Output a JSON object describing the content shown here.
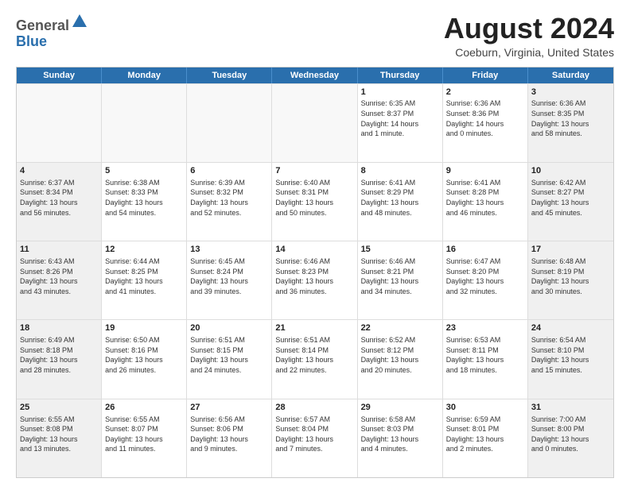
{
  "logo": {
    "general": "General",
    "blue": "Blue"
  },
  "header": {
    "month": "August 2024",
    "location": "Coeburn, Virginia, United States"
  },
  "days": [
    "Sunday",
    "Monday",
    "Tuesday",
    "Wednesday",
    "Thursday",
    "Friday",
    "Saturday"
  ],
  "rows": [
    [
      {
        "day": "",
        "empty": true
      },
      {
        "day": "",
        "empty": true
      },
      {
        "day": "",
        "empty": true
      },
      {
        "day": "",
        "empty": true
      },
      {
        "day": "1",
        "lines": [
          "Sunrise: 6:35 AM",
          "Sunset: 8:37 PM",
          "Daylight: 14 hours",
          "and 1 minute."
        ]
      },
      {
        "day": "2",
        "lines": [
          "Sunrise: 6:36 AM",
          "Sunset: 8:36 PM",
          "Daylight: 14 hours",
          "and 0 minutes."
        ]
      },
      {
        "day": "3",
        "shaded": true,
        "lines": [
          "Sunrise: 6:36 AM",
          "Sunset: 8:35 PM",
          "Daylight: 13 hours",
          "and 58 minutes."
        ]
      }
    ],
    [
      {
        "day": "4",
        "shaded": true,
        "lines": [
          "Sunrise: 6:37 AM",
          "Sunset: 8:34 PM",
          "Daylight: 13 hours",
          "and 56 minutes."
        ]
      },
      {
        "day": "5",
        "lines": [
          "Sunrise: 6:38 AM",
          "Sunset: 8:33 PM",
          "Daylight: 13 hours",
          "and 54 minutes."
        ]
      },
      {
        "day": "6",
        "lines": [
          "Sunrise: 6:39 AM",
          "Sunset: 8:32 PM",
          "Daylight: 13 hours",
          "and 52 minutes."
        ]
      },
      {
        "day": "7",
        "lines": [
          "Sunrise: 6:40 AM",
          "Sunset: 8:31 PM",
          "Daylight: 13 hours",
          "and 50 minutes."
        ]
      },
      {
        "day": "8",
        "lines": [
          "Sunrise: 6:41 AM",
          "Sunset: 8:29 PM",
          "Daylight: 13 hours",
          "and 48 minutes."
        ]
      },
      {
        "day": "9",
        "lines": [
          "Sunrise: 6:41 AM",
          "Sunset: 8:28 PM",
          "Daylight: 13 hours",
          "and 46 minutes."
        ]
      },
      {
        "day": "10",
        "shaded": true,
        "lines": [
          "Sunrise: 6:42 AM",
          "Sunset: 8:27 PM",
          "Daylight: 13 hours",
          "and 45 minutes."
        ]
      }
    ],
    [
      {
        "day": "11",
        "shaded": true,
        "lines": [
          "Sunrise: 6:43 AM",
          "Sunset: 8:26 PM",
          "Daylight: 13 hours",
          "and 43 minutes."
        ]
      },
      {
        "day": "12",
        "lines": [
          "Sunrise: 6:44 AM",
          "Sunset: 8:25 PM",
          "Daylight: 13 hours",
          "and 41 minutes."
        ]
      },
      {
        "day": "13",
        "lines": [
          "Sunrise: 6:45 AM",
          "Sunset: 8:24 PM",
          "Daylight: 13 hours",
          "and 39 minutes."
        ]
      },
      {
        "day": "14",
        "lines": [
          "Sunrise: 6:46 AM",
          "Sunset: 8:23 PM",
          "Daylight: 13 hours",
          "and 36 minutes."
        ]
      },
      {
        "day": "15",
        "lines": [
          "Sunrise: 6:46 AM",
          "Sunset: 8:21 PM",
          "Daylight: 13 hours",
          "and 34 minutes."
        ]
      },
      {
        "day": "16",
        "lines": [
          "Sunrise: 6:47 AM",
          "Sunset: 8:20 PM",
          "Daylight: 13 hours",
          "and 32 minutes."
        ]
      },
      {
        "day": "17",
        "shaded": true,
        "lines": [
          "Sunrise: 6:48 AM",
          "Sunset: 8:19 PM",
          "Daylight: 13 hours",
          "and 30 minutes."
        ]
      }
    ],
    [
      {
        "day": "18",
        "shaded": true,
        "lines": [
          "Sunrise: 6:49 AM",
          "Sunset: 8:18 PM",
          "Daylight: 13 hours",
          "and 28 minutes."
        ]
      },
      {
        "day": "19",
        "lines": [
          "Sunrise: 6:50 AM",
          "Sunset: 8:16 PM",
          "Daylight: 13 hours",
          "and 26 minutes."
        ]
      },
      {
        "day": "20",
        "lines": [
          "Sunrise: 6:51 AM",
          "Sunset: 8:15 PM",
          "Daylight: 13 hours",
          "and 24 minutes."
        ]
      },
      {
        "day": "21",
        "lines": [
          "Sunrise: 6:51 AM",
          "Sunset: 8:14 PM",
          "Daylight: 13 hours",
          "and 22 minutes."
        ]
      },
      {
        "day": "22",
        "lines": [
          "Sunrise: 6:52 AM",
          "Sunset: 8:12 PM",
          "Daylight: 13 hours",
          "and 20 minutes."
        ]
      },
      {
        "day": "23",
        "lines": [
          "Sunrise: 6:53 AM",
          "Sunset: 8:11 PM",
          "Daylight: 13 hours",
          "and 18 minutes."
        ]
      },
      {
        "day": "24",
        "shaded": true,
        "lines": [
          "Sunrise: 6:54 AM",
          "Sunset: 8:10 PM",
          "Daylight: 13 hours",
          "and 15 minutes."
        ]
      }
    ],
    [
      {
        "day": "25",
        "shaded": true,
        "lines": [
          "Sunrise: 6:55 AM",
          "Sunset: 8:08 PM",
          "Daylight: 13 hours",
          "and 13 minutes."
        ]
      },
      {
        "day": "26",
        "lines": [
          "Sunrise: 6:55 AM",
          "Sunset: 8:07 PM",
          "Daylight: 13 hours",
          "and 11 minutes."
        ]
      },
      {
        "day": "27",
        "lines": [
          "Sunrise: 6:56 AM",
          "Sunset: 8:06 PM",
          "Daylight: 13 hours",
          "and 9 minutes."
        ]
      },
      {
        "day": "28",
        "lines": [
          "Sunrise: 6:57 AM",
          "Sunset: 8:04 PM",
          "Daylight: 13 hours",
          "and 7 minutes."
        ]
      },
      {
        "day": "29",
        "lines": [
          "Sunrise: 6:58 AM",
          "Sunset: 8:03 PM",
          "Daylight: 13 hours",
          "and 4 minutes."
        ]
      },
      {
        "day": "30",
        "lines": [
          "Sunrise: 6:59 AM",
          "Sunset: 8:01 PM",
          "Daylight: 13 hours",
          "and 2 minutes."
        ]
      },
      {
        "day": "31",
        "shaded": true,
        "lines": [
          "Sunrise: 7:00 AM",
          "Sunset: 8:00 PM",
          "Daylight: 13 hours",
          "and 0 minutes."
        ]
      }
    ]
  ]
}
